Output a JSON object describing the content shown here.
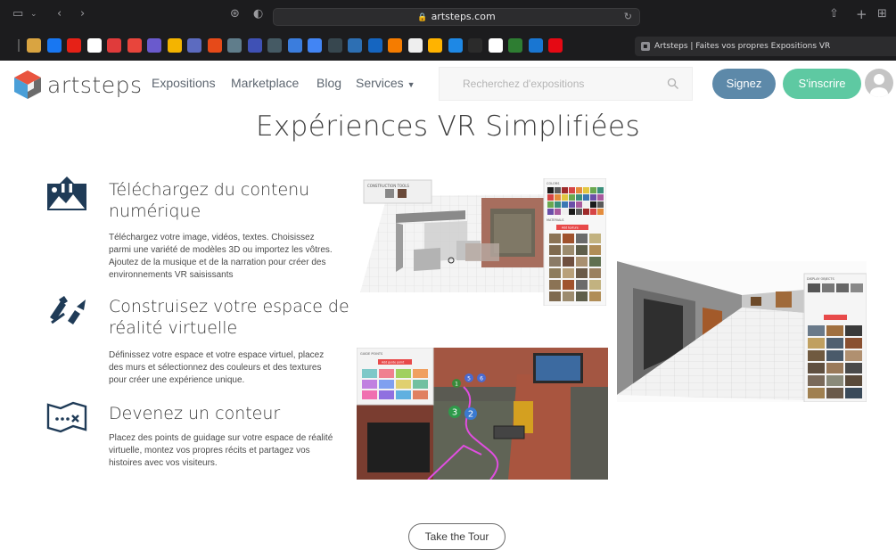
{
  "browser": {
    "url": "artsteps.com",
    "active_tab": "Artsteps | Faites vos propres Expositions VR",
    "favicons": [
      {
        "color": "#d9a441"
      },
      {
        "color": "#1877f2"
      },
      {
        "color": "#e62117"
      },
      {
        "color": "#ffffff"
      },
      {
        "color": "#e03b3b"
      },
      {
        "color": "#e8453c"
      },
      {
        "color": "#6a5acd"
      },
      {
        "color": "#f4b400"
      },
      {
        "color": "#5c6bc0"
      },
      {
        "color": "#e64a19"
      },
      {
        "color": "#607d8b"
      },
      {
        "color": "#3f51b5"
      },
      {
        "color": "#455a64"
      },
      {
        "color": "#3b7ddd"
      },
      {
        "color": "#4285f4"
      },
      {
        "color": "#37474f"
      },
      {
        "color": "#2d6fb3"
      },
      {
        "color": "#1565c0"
      },
      {
        "color": "#f57c00"
      },
      {
        "color": "#eeeeee"
      },
      {
        "color": "#ffb300"
      },
      {
        "color": "#1e88e5"
      },
      {
        "color": "#2b2b2b"
      },
      {
        "color": "#ffffff"
      },
      {
        "color": "#2e7d32"
      },
      {
        "color": "#1976d2"
      },
      {
        "color": "#e50914"
      }
    ]
  },
  "site": {
    "logo_text": "artsteps",
    "nav": [
      "Expositions",
      "Marketplace",
      "Blog",
      "Services"
    ],
    "search_placeholder": "Recherchez d'expositions",
    "signin_label": "Signez",
    "signup_label": "S'inscrire"
  },
  "main": {
    "title": "Expériences VR Simplifiées",
    "features": [
      {
        "icon": "upload-mountain-icon",
        "title": "Téléchargez du contenu numérique",
        "desc": "Téléchargez votre image, vidéos, textes. Choisissez parmi une variété de modèles 3D ou importez les vôtres. Ajoutez de la musique et de la narration pour créer des environnements VR saisissants"
      },
      {
        "icon": "build-tools-icon",
        "title": "Construisez votre espace de réalité virtuelle",
        "desc": "Définissez votre espace et votre espace virtuel, placez des murs et sélectionnez des couleurs et des textures pour créer une expérience unique."
      },
      {
        "icon": "story-map-icon",
        "title": "Devenez un conteur",
        "desc": "Placez des points de guidage sur votre espace de réalité virtuelle, montez vos propres récits et partagez vos histoires avec vos visiteurs."
      }
    ],
    "tour_button": "Take the Tour"
  },
  "previews": {
    "construction_label": "CONSTRUCTION TOOLS",
    "colors_label": "COLORS",
    "materials_label": "MATERIALS",
    "add_texture": "Add texture",
    "display_label": "DISPLAY OBJECTS",
    "guide_label": "GUIDE POINTS",
    "add_guide": "Add guide point",
    "guide_numbers": [
      "1",
      "5",
      "6",
      "3",
      "2"
    ]
  }
}
